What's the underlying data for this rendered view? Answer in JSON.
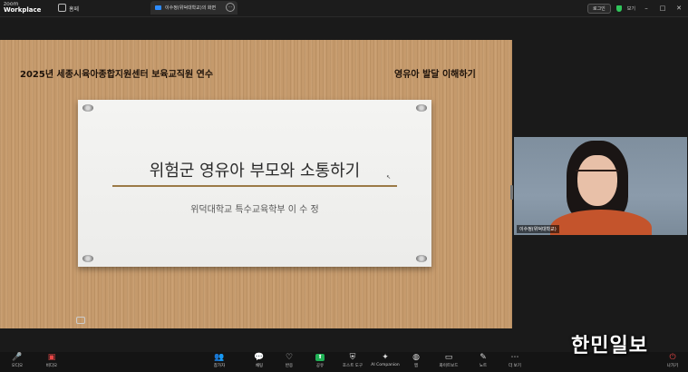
{
  "titlebar": {
    "brand_line1": "zoom",
    "brand_line2": "Workplace",
    "home_tab": "홈페",
    "meeting_tab": "이수정(위덕대학교)의 화면",
    "meeting_tab_close": "⋯",
    "pill_label": "로그인",
    "shield_text": "보기",
    "minimize": "–",
    "maximize": "□",
    "close": "✕"
  },
  "slide": {
    "header_left": "2025년 세종시육아종합지원센터 보육교직원 연수",
    "header_right": "영유아 발달 이해하기",
    "title": "위험군 영유아 부모와 소통하기",
    "subtitle": "위덕대학교 특수교육학부    이 수 정"
  },
  "video": {
    "participant_name": "이수정(위덕대학교)"
  },
  "toolbar": {
    "items": [
      {
        "label": "오디오",
        "glyph": "🎤"
      },
      {
        "label": "비디오",
        "glyph": "▣"
      },
      {
        "label": "참가자",
        "glyph": "👥"
      },
      {
        "label": "채팅",
        "glyph": "💬"
      },
      {
        "label": "반응",
        "glyph": "♡"
      },
      {
        "label": "공유",
        "glyph": "⬆"
      },
      {
        "label": "호스트 도구",
        "glyph": "⛨"
      },
      {
        "label": "AI Companion",
        "glyph": "✦"
      },
      {
        "label": "앱",
        "glyph": "◍"
      },
      {
        "label": "화이트보드",
        "glyph": "▭"
      },
      {
        "label": "노트",
        "glyph": "✎"
      },
      {
        "label": "더 보기",
        "glyph": "⋯"
      },
      {
        "label": "나가기",
        "glyph": "⏻"
      }
    ]
  },
  "watermark": "한민일보",
  "colors": {
    "wood": "#c59a6c",
    "accent_green": "#1fb155",
    "zoom_blue": "#2d8cff"
  }
}
